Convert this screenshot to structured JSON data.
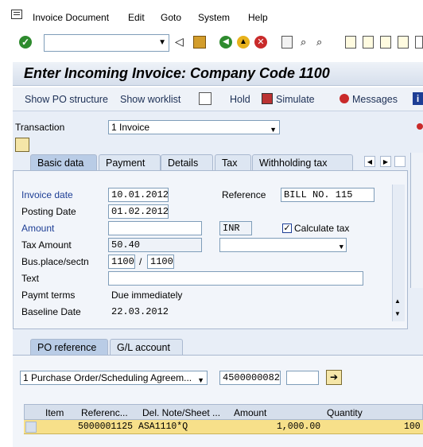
{
  "menubar": {
    "items": [
      "Invoice Document",
      "Edit",
      "Goto",
      "System",
      "Help"
    ]
  },
  "toolbar": {
    "command_value": ""
  },
  "title": "Enter Incoming Invoice: Company Code 1100",
  "appbar": {
    "show_po_structure": "Show PO structure",
    "show_worklist": "Show worklist",
    "hold": "Hold",
    "simulate": "Simulate",
    "messages": "Messages"
  },
  "transaction": {
    "label": "Transaction",
    "value": "1 Invoice"
  },
  "tabs": [
    "Basic data",
    "Payment",
    "Details",
    "Tax",
    "Withholding tax"
  ],
  "basic": {
    "invoice_date_label": "Invoice date",
    "invoice_date": "10.01.2012",
    "reference_label": "Reference",
    "reference": "BILL NO. 115",
    "posting_date_label": "Posting Date",
    "posting_date": "01.02.2012",
    "amount_label": "Amount",
    "amount": "",
    "currency": "INR",
    "calculate_tax_label": "Calculate tax",
    "tax_amount_label": "Tax Amount",
    "tax_amount": "50.40",
    "tax_code": "",
    "bus_place_label": "Bus.place/sectn",
    "bus_place": "1100",
    "sep": "/",
    "section": "1100",
    "text_label": "Text",
    "text": "",
    "paymt_terms_label": "Paymt terms",
    "paymt_terms": "Due immediately",
    "baseline_label": "Baseline Date",
    "baseline": "22.03.2012"
  },
  "lower_tabs": [
    "PO reference",
    "G/L account"
  ],
  "po": {
    "doc_type": "1 Purchase Order/Scheduling Agreem...",
    "po_number": "4500000082",
    "item": ""
  },
  "grid": {
    "headers": [
      "Item",
      "Referenc...",
      "Del. Note/Sheet ...",
      "Amount",
      "Quantity"
    ],
    "row": [
      "",
      "5000001125",
      "ASA1110*Q",
      "1,000.00",
      "100"
    ]
  },
  "colors": {
    "accent_blue": "#1d3e95",
    "row_highlight": "#f7e08a"
  }
}
